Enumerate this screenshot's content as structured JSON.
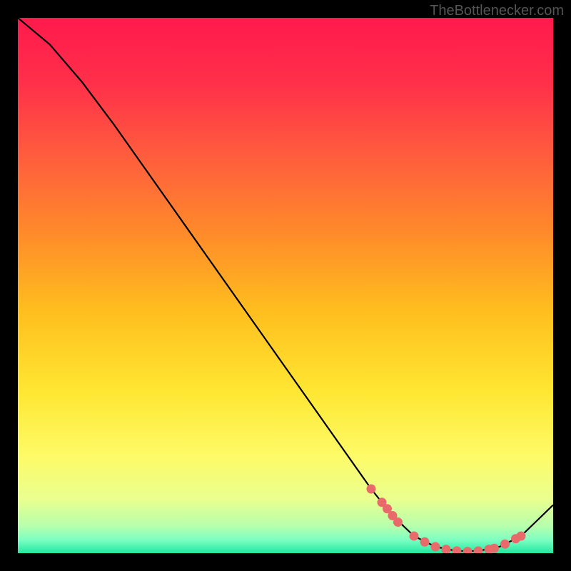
{
  "watermark": "TheBottlenecker.com",
  "chart_data": {
    "type": "line",
    "title": "",
    "xlabel": "",
    "ylabel": "",
    "xlim": [
      0,
      100
    ],
    "ylim": [
      0,
      100
    ],
    "series": [
      {
        "name": "curve",
        "x": [
          0,
          6,
          12,
          18,
          24,
          30,
          36,
          42,
          48,
          54,
          60,
          66,
          70,
          74,
          78,
          82,
          86,
          90,
          94,
          100
        ],
        "y": [
          100,
          95,
          88,
          80,
          71.5,
          63,
          54.5,
          46,
          37.5,
          29,
          20.5,
          12,
          7,
          3.2,
          1.2,
          0.4,
          0.4,
          1.2,
          3.2,
          9
        ]
      }
    ],
    "highlight_points": {
      "x": [
        66,
        68,
        69,
        70,
        71,
        74,
        76,
        78,
        80,
        82,
        84,
        86,
        88,
        89,
        91,
        93,
        94
      ],
      "y": [
        12,
        9.5,
        8.3,
        7,
        5.8,
        3.2,
        2.1,
        1.2,
        0.7,
        0.4,
        0.3,
        0.4,
        0.7,
        0.9,
        1.7,
        2.7,
        3.2
      ]
    },
    "gradient_stops": [
      {
        "offset": 0.0,
        "color": "#ff1a4c"
      },
      {
        "offset": 0.12,
        "color": "#ff2f4a"
      },
      {
        "offset": 0.25,
        "color": "#ff5a3e"
      },
      {
        "offset": 0.4,
        "color": "#ff8a2a"
      },
      {
        "offset": 0.55,
        "color": "#ffbf1e"
      },
      {
        "offset": 0.7,
        "color": "#ffe733"
      },
      {
        "offset": 0.82,
        "color": "#fdfb68"
      },
      {
        "offset": 0.9,
        "color": "#e9ff8f"
      },
      {
        "offset": 0.95,
        "color": "#b6ffad"
      },
      {
        "offset": 0.975,
        "color": "#7dffc2"
      },
      {
        "offset": 1.0,
        "color": "#24e7a0"
      }
    ],
    "marker_color": "#e86a6a",
    "curve_color": "#000000"
  }
}
